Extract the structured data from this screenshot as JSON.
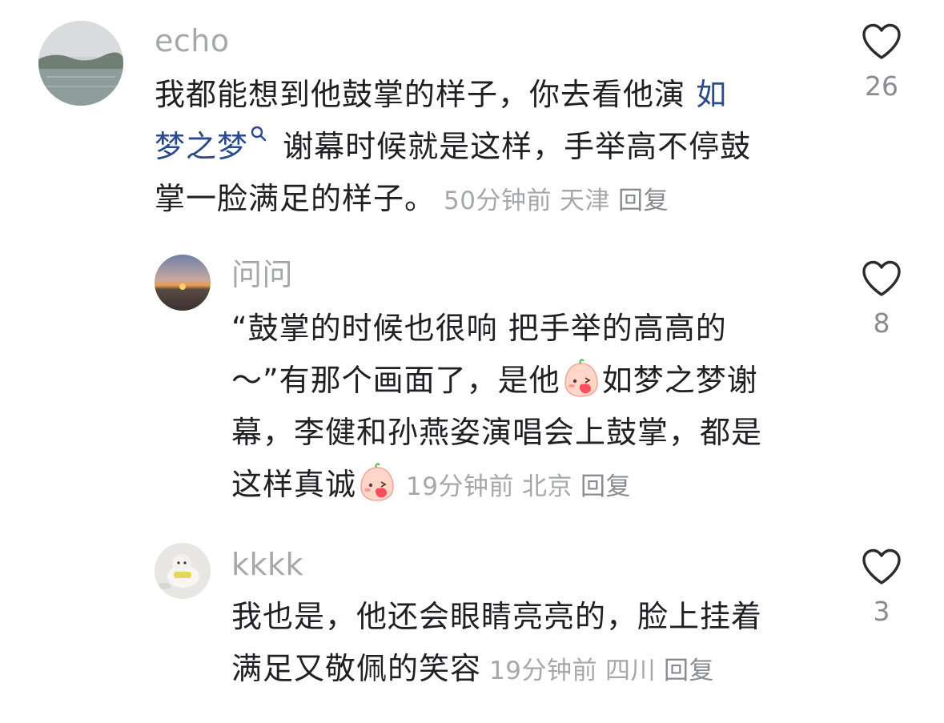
{
  "comments": [
    {
      "username": "echo",
      "text_parts": [
        "我都能想到他鼓掌的样子，你去看他演 ",
        "如梦之梦",
        " 谢幕时候就是这样，手举高不停鼓掌一脸满足的样子。"
      ],
      "line1": "我都能想到他鼓掌的样子，你去看他演 ",
      "link_line1": "如",
      "link_line2": "梦之梦",
      "line2_rest": " 谢幕时候就是这样，手举高不停鼓",
      "line3": "掌一脸满足的样子。",
      "time": "50分钟前",
      "location": "天津",
      "reply": "回复",
      "likes": "26"
    },
    {
      "username": "问问",
      "line1": "“鼓掌的时候也很响 把手举的高高的",
      "line2a": "～”有那个画面了，是他",
      "line2b": "如梦之梦谢",
      "line3": "幕，李健和孙燕姿演唱会上鼓掌，都是",
      "line4": "这样真诚",
      "time": "19分钟前",
      "location": "北京",
      "reply": "回复",
      "likes": "8"
    },
    {
      "username": "kkkk",
      "line1": "我也是，他还会眼睛亮亮的，脸上挂着",
      "line2": "满足又敬佩的笑容",
      "time": "19分钟前",
      "location": "四川",
      "reply": "回复",
      "likes": "3"
    }
  ],
  "icons": {
    "like": "heart-outline-icon",
    "search": "search-icon",
    "emoji": "blushing-peach-emoji"
  },
  "colors": {
    "text": "#1f1f24",
    "meta": "#a6a7ab",
    "link": "#2b4a8c"
  }
}
